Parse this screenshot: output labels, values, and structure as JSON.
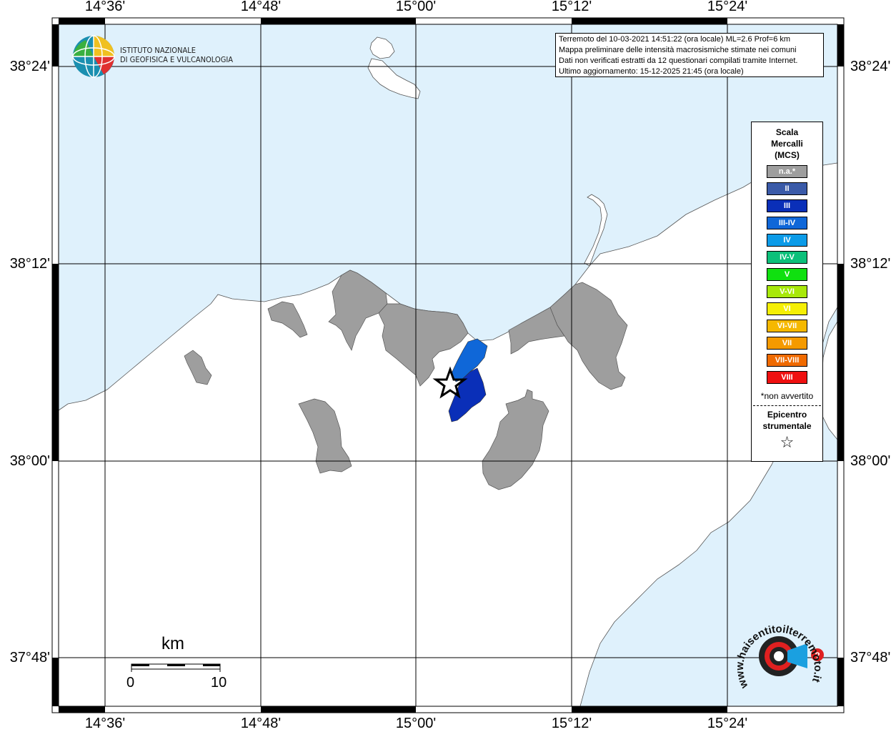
{
  "axes": {
    "longitude_labels": [
      "14°36'",
      "14°48'",
      "15°00'",
      "15°12'",
      "15°24'"
    ],
    "latitude_labels": [
      "38°24'",
      "38°12'",
      "38°00'",
      "37°48'"
    ]
  },
  "header": {
    "logo_line1": "ISTITUTO NAZIONALE",
    "logo_line2": "DI GEOFISICA E VULCANOLOGIA"
  },
  "info": {
    "line1": "Terremoto del 10-03-2021 14:51:22 (ora locale) ML=2.6 Prof=6 km",
    "line2": "Mappa preliminare delle intensità macrosismiche stimate nei comuni",
    "line3": "Dati non verificati estratti da 12 questionari compilati tramite Internet.",
    "line4": "Ultimo aggiornamento: 15-12-2025 21:45 (ora locale)"
  },
  "legend": {
    "title_line1": "Scala",
    "title_line2": "Mercalli",
    "title_line3": "(MCS)",
    "items": [
      {
        "label": "n.a.*",
        "color": "#9e9e9e"
      },
      {
        "label": "II",
        "color": "#3a5aa8"
      },
      {
        "label": "III",
        "color": "#0a2fb8"
      },
      {
        "label": "III-IV",
        "color": "#0f67d8"
      },
      {
        "label": "IV",
        "color": "#0b9be8"
      },
      {
        "label": "IV-V",
        "color": "#0cc07a"
      },
      {
        "label": "V",
        "color": "#10e010"
      },
      {
        "label": "V-VI",
        "color": "#a8e80a"
      },
      {
        "label": "VI",
        "color": "#f5ef06"
      },
      {
        "label": "VI-VII",
        "color": "#f5b800"
      },
      {
        "label": "VII",
        "color": "#f59a00"
      },
      {
        "label": "VII-VIII",
        "color": "#f06a00"
      },
      {
        "label": "VIII",
        "color": "#ef1010"
      }
    ],
    "note": "*non avvertito",
    "epicentre_line1": "Epicentro",
    "epicentre_line2": "strumentale",
    "epicentre_symbol": "☆"
  },
  "scale_bar": {
    "unit": "km",
    "min": "0",
    "max": "10"
  },
  "colors": {
    "sea": "#dff1fc",
    "land": "#ffffff",
    "municipality_na": "#9e9e9e",
    "intensity_III": "#0a2fb8",
    "intensity_III_IV": "#0f67d8"
  },
  "watermark": {
    "text": "www.haisentitoilterremoto.it"
  }
}
